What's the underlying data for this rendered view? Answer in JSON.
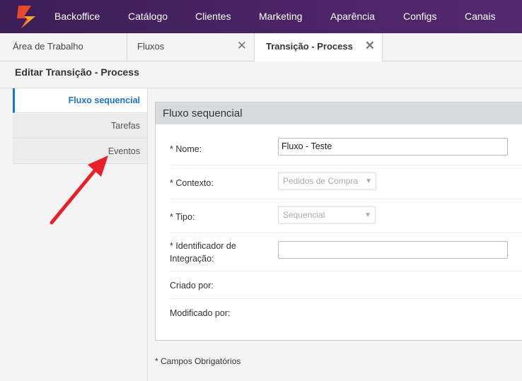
{
  "nav": {
    "items": [
      {
        "label": "Backoffice"
      },
      {
        "label": "Catálogo"
      },
      {
        "label": "Clientes"
      },
      {
        "label": "Marketing"
      },
      {
        "label": "Aparência"
      },
      {
        "label": "Configs"
      },
      {
        "label": "Canais"
      }
    ],
    "colors": {
      "bar": "#4a2466",
      "logo_a": "#e8492c",
      "logo_b": "#f6a623"
    }
  },
  "tabs": [
    {
      "label": "Área de Trabalho",
      "closable": false,
      "active": false
    },
    {
      "label": "Fluxos",
      "closable": true,
      "active": false
    },
    {
      "label": "Transição - Process",
      "closable": true,
      "active": true
    }
  ],
  "tab_close_glyph": "✕",
  "page_title": "Editar Transição - Process",
  "sidebar": {
    "items": [
      {
        "label": "Fluxo sequencial",
        "active": true
      },
      {
        "label": "Tarefas",
        "active": false
      },
      {
        "label": "Eventos",
        "active": false
      }
    ],
    "accent": "#1a73c7"
  },
  "panel": {
    "title": "Fluxo sequencial",
    "fields": {
      "nome": {
        "label": "* Nome:",
        "value": "Fluxo - Teste"
      },
      "contexto": {
        "label": "* Contexto:",
        "value": "Pedidos de Compra"
      },
      "tipo": {
        "label": "* Tipo:",
        "value": "Sequencial"
      },
      "identificador": {
        "label_line1": "* Identificador de",
        "label_line2": "Integração:",
        "value": ""
      },
      "criado": {
        "label": "Criado por:"
      },
      "modificado": {
        "label": "Modificado por:"
      }
    }
  },
  "caret_glyph": "▼",
  "footer_note": "* Campos Obrigatórios",
  "annotation_arrow_color": "#e8202a"
}
